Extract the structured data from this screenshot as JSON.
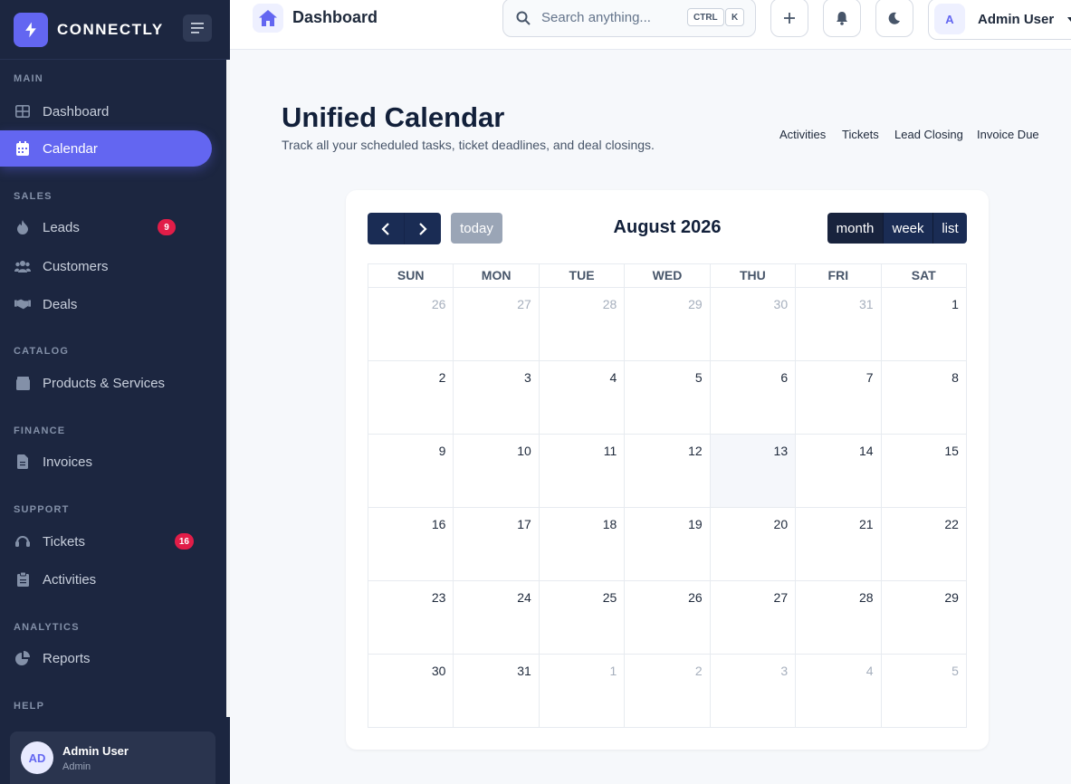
{
  "sidebar": {
    "brand": "CONNECTLY",
    "sections": {
      "main": "MAIN",
      "sales": "SALES",
      "catalog": "CATALOG",
      "finance": "FINANCE",
      "support": "SUPPORT",
      "analytics": "ANALYTICS",
      "help": "HELP"
    },
    "items": {
      "dashboard": "Dashboard",
      "calendar": "Calendar",
      "leads": "Leads",
      "leads_badge": "9",
      "customers": "Customers",
      "deals": "Deals",
      "products": "Products & Services",
      "invoices": "Invoices",
      "tickets": "Tickets",
      "tickets_badge": "16",
      "activities": "Activities",
      "reports": "Reports"
    },
    "user": {
      "initials": "AD",
      "name": "Admin User",
      "role": "Admin"
    }
  },
  "topbar": {
    "title": "Dashboard",
    "search_placeholder": "Search anything...",
    "kbd_ctrl": "CTRL",
    "kbd_k": "K",
    "profile_initial": "A",
    "profile_name": "Admin User"
  },
  "page": {
    "title": "Unified Calendar",
    "subtitle": "Track all your scheduled tasks, ticket deadlines, and deal closings.",
    "legend": [
      "Activities",
      "Tickets",
      "Lead Closing",
      "Invoice Due"
    ]
  },
  "calendar": {
    "title": "August 2026",
    "today_label": "today",
    "views": {
      "month": "month",
      "week": "week",
      "list": "list"
    },
    "active_view": "month",
    "weekdays": [
      "SUN",
      "MON",
      "TUE",
      "WED",
      "THU",
      "FRI",
      "SAT"
    ],
    "weeks": [
      [
        {
          "d": "26",
          "o": true
        },
        {
          "d": "27",
          "o": true
        },
        {
          "d": "28",
          "o": true
        },
        {
          "d": "29",
          "o": true
        },
        {
          "d": "30",
          "o": true
        },
        {
          "d": "31",
          "o": true
        },
        {
          "d": "1"
        }
      ],
      [
        {
          "d": "2"
        },
        {
          "d": "3"
        },
        {
          "d": "4"
        },
        {
          "d": "5"
        },
        {
          "d": "6"
        },
        {
          "d": "7"
        },
        {
          "d": "8"
        }
      ],
      [
        {
          "d": "9"
        },
        {
          "d": "10"
        },
        {
          "d": "11"
        },
        {
          "d": "12"
        },
        {
          "d": "13",
          "t": true
        },
        {
          "d": "14"
        },
        {
          "d": "15"
        }
      ],
      [
        {
          "d": "16"
        },
        {
          "d": "17"
        },
        {
          "d": "18"
        },
        {
          "d": "19"
        },
        {
          "d": "20"
        },
        {
          "d": "21"
        },
        {
          "d": "22"
        }
      ],
      [
        {
          "d": "23"
        },
        {
          "d": "24"
        },
        {
          "d": "25"
        },
        {
          "d": "26"
        },
        {
          "d": "27"
        },
        {
          "d": "28"
        },
        {
          "d": "29"
        }
      ],
      [
        {
          "d": "30"
        },
        {
          "d": "31"
        },
        {
          "d": "1",
          "o": true
        },
        {
          "d": "2",
          "o": true
        },
        {
          "d": "3",
          "o": true
        },
        {
          "d": "4",
          "o": true
        },
        {
          "d": "5",
          "o": true
        }
      ]
    ]
  },
  "colors": {
    "accent": "#6366f1",
    "sidebar_bg": "#1c2640",
    "badge": "#e11d48",
    "calendar_button": "#1a2c54"
  }
}
